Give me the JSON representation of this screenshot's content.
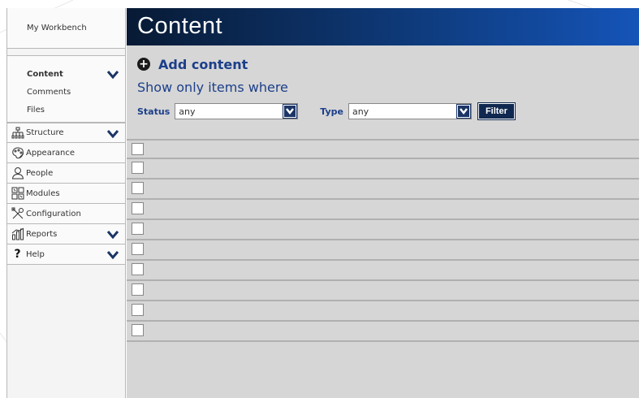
{
  "sidebar": {
    "workbench": "My Workbench",
    "content_group": {
      "items": [
        {
          "label": "Content",
          "active": true
        },
        {
          "label": "Comments"
        },
        {
          "label": "Files"
        }
      ]
    },
    "nav": [
      {
        "label": "Structure",
        "icon": "structure-icon",
        "expandable": true
      },
      {
        "label": "Appearance",
        "icon": "appearance-icon",
        "expandable": false
      },
      {
        "label": "People",
        "icon": "people-icon",
        "expandable": false
      },
      {
        "label": "Modules",
        "icon": "modules-icon",
        "expandable": false
      },
      {
        "label": "Configuration",
        "icon": "configuration-icon",
        "expandable": false
      },
      {
        "label": "Reports",
        "icon": "reports-icon",
        "expandable": true
      },
      {
        "label": "Help",
        "icon": "help-icon",
        "expandable": true
      }
    ]
  },
  "main": {
    "title": "Content",
    "add_content": "Add content",
    "show_only": "Show only items where",
    "filters": {
      "status_label": "Status",
      "status_value": "any",
      "type_label": "Type",
      "type_value": "any",
      "filter_button": "Filter"
    },
    "row_count": 10
  },
  "colors": {
    "accent": "#1c3f8a",
    "title_bar_start": "#081a34",
    "title_bar_end": "#1554b8",
    "main_bg": "#d6d6d6"
  }
}
